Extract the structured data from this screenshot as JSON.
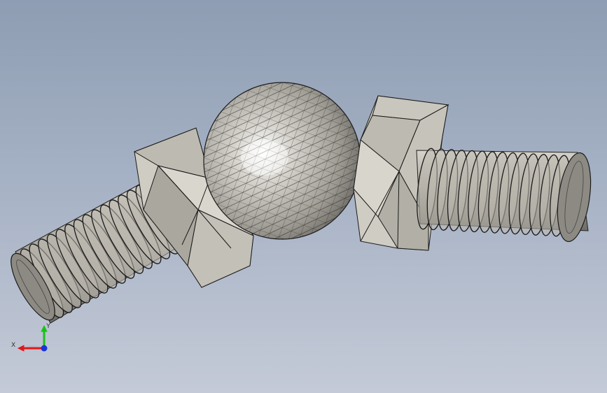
{
  "viewport": {
    "background_top": "#8e9db3",
    "background_bottom": "#c4cad7"
  },
  "model": {
    "body_color": "#cfccc3",
    "edge_color": "#1a1a18",
    "parts": [
      "threaded-shaft-left",
      "hex-nut-left",
      "ball",
      "hex-nut-right",
      "threaded-shaft-right"
    ]
  },
  "triad": {
    "x_label": "X",
    "y_label": "Y",
    "x_color": "#e01919",
    "y_color": "#19c119",
    "z_color": "#1a35d8"
  }
}
